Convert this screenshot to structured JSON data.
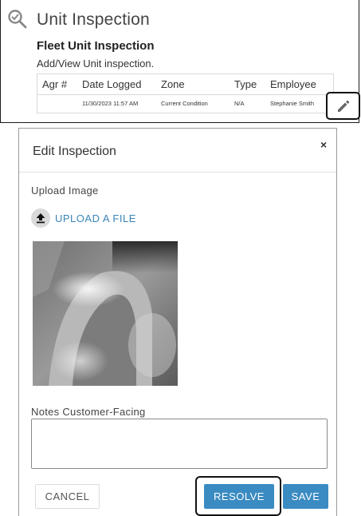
{
  "page": {
    "title": "Unit Inspection",
    "icon": "search-check-icon"
  },
  "section": {
    "title": "Fleet Unit Inspection",
    "subtitle": "Add/View Unit inspection."
  },
  "table": {
    "columns": [
      "Agr #",
      "Date Logged",
      "Zone",
      "Type",
      "Employee"
    ],
    "rows": [
      {
        "agr": "",
        "date_logged": "11/30/2023 11:57 AM",
        "zone": "Current Condition",
        "type": "N/A",
        "employee": "Stephanie Smith"
      }
    ],
    "row_action_icon": "pencil-icon"
  },
  "modal": {
    "title": "Edit Inspection",
    "close_label": "×",
    "upload_label": "Upload Image",
    "upload_button": "UPLOAD A FILE",
    "upload_icon": "upload-arrow-icon",
    "notes_label": "Notes Customer-Facing",
    "notes_value": "",
    "buttons": {
      "cancel": "CANCEL",
      "resolve": "RESOLVE",
      "save": "SAVE"
    }
  },
  "colors": {
    "accent": "#3a8bc2",
    "link": "#3a85b8",
    "highlight_outline": "#111111"
  }
}
